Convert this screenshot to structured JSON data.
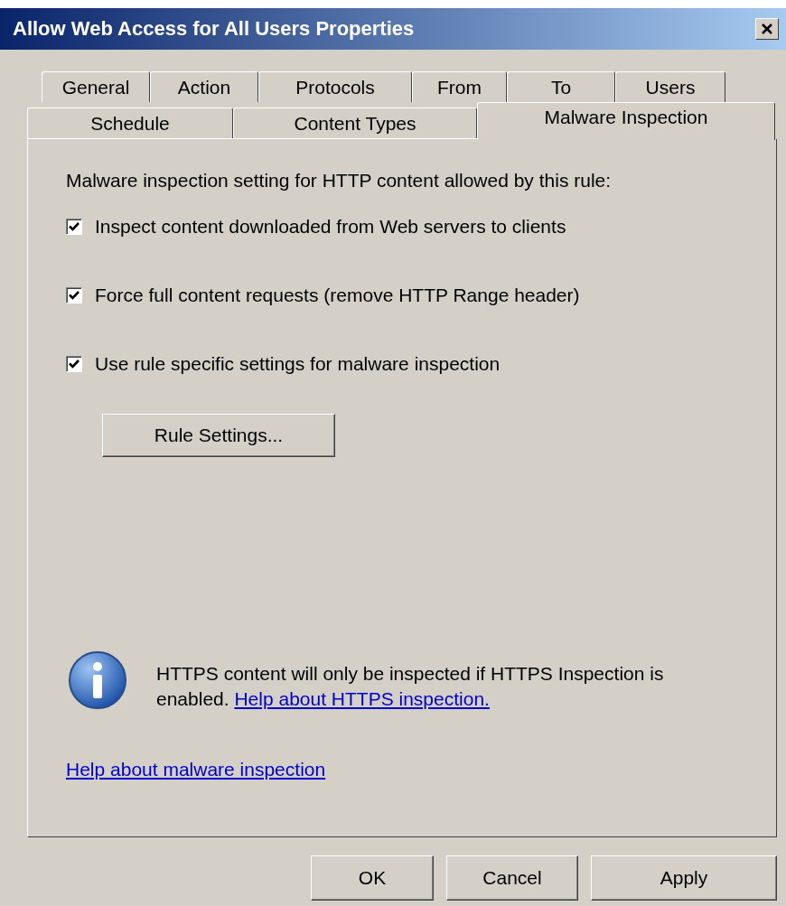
{
  "window": {
    "title": "Allow Web Access for All Users Properties"
  },
  "tab_rows": [
    [
      {
        "label": "General",
        "selected": false
      },
      {
        "label": "Action",
        "selected": false
      },
      {
        "label": "Protocols",
        "selected": false
      },
      {
        "label": "From",
        "selected": false
      },
      {
        "label": "To",
        "selected": false
      },
      {
        "label": "Users",
        "selected": false
      }
    ],
    [
      {
        "label": "Schedule",
        "selected": false
      },
      {
        "label": "Content Types",
        "selected": false
      },
      {
        "label": "Malware Inspection",
        "selected": true
      }
    ]
  ],
  "heading": "Malware inspection setting for HTTP content allowed by this rule:",
  "options": [
    {
      "label": "Inspect content downloaded from Web servers to clients",
      "checked": true
    },
    {
      "label": "Force full content requests (remove HTTP Range header)",
      "checked": true
    },
    {
      "label": "Use rule specific settings for malware inspection",
      "checked": true
    }
  ],
  "rule_settings_button": "Rule Settings...",
  "info": {
    "text": "HTTPS content will only be inspected if HTTPS Inspection is enabled.",
    "link": "Help about HTTPS inspection."
  },
  "help_link": "Help about malware inspection",
  "buttons": [
    {
      "label": "OK"
    },
    {
      "label": "Cancel"
    },
    {
      "label": "Apply"
    }
  ]
}
